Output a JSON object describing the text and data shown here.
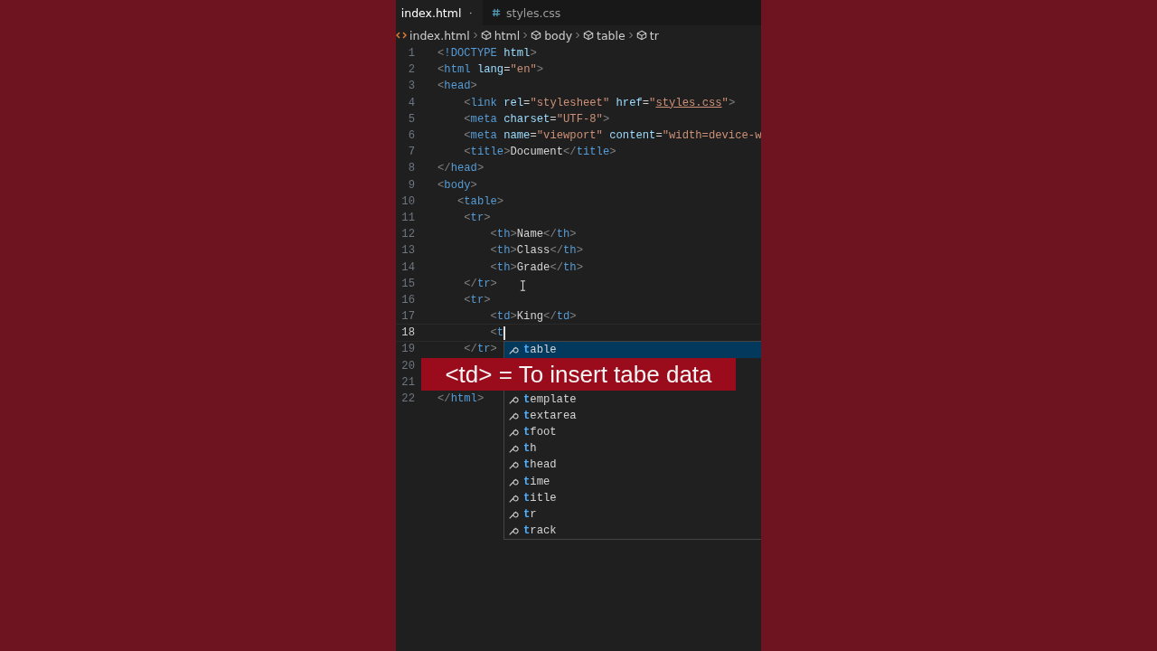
{
  "tabs": [
    {
      "label": "index.html",
      "selected": true,
      "modified": true
    },
    {
      "label": "styles.css",
      "selected": false,
      "modified": false
    }
  ],
  "breadcrumb": [
    {
      "label": "index.html"
    },
    {
      "label": "html"
    },
    {
      "label": "body"
    },
    {
      "label": "table"
    },
    {
      "label": "tr"
    }
  ],
  "lines": [
    {
      "number": "1",
      "current": false,
      "tokens": [
        {
          "t": "<",
          "kind": "punct"
        },
        {
          "t": "!DOCTYPE",
          "kind": "tag"
        },
        {
          "t": " html",
          "kind": "attr"
        },
        {
          "t": ">",
          "kind": "punct"
        }
      ]
    },
    {
      "number": "2",
      "current": false,
      "tokens": [
        {
          "t": "<",
          "kind": "punct"
        },
        {
          "t": "html",
          "kind": "tag"
        },
        {
          "t": " lang",
          "kind": "attr"
        },
        {
          "t": "=",
          "kind": "text"
        },
        {
          "t": "\"en\"",
          "kind": "string"
        },
        {
          "t": ">",
          "kind": "punct"
        }
      ]
    },
    {
      "number": "3",
      "current": false,
      "tokens": [
        {
          "t": "<",
          "kind": "punct"
        },
        {
          "t": "head",
          "kind": "tag"
        },
        {
          "t": ">",
          "kind": "punct"
        }
      ]
    },
    {
      "number": "4",
      "current": false,
      "tokens": [
        {
          "t": "    <",
          "kind": "punct"
        },
        {
          "t": "link",
          "kind": "tag"
        },
        {
          "t": " rel",
          "kind": "attr"
        },
        {
          "t": "=",
          "kind": "text"
        },
        {
          "t": "\"stylesheet\"",
          "kind": "string"
        },
        {
          "t": " href",
          "kind": "attr"
        },
        {
          "t": "=",
          "kind": "text"
        },
        {
          "t": "\"",
          "kind": "string"
        },
        {
          "t": "styles.css",
          "kind": "link"
        },
        {
          "t": "\"",
          "kind": "string"
        },
        {
          "t": ">",
          "kind": "punct"
        }
      ]
    },
    {
      "number": "5",
      "current": false,
      "tokens": [
        {
          "t": "    <",
          "kind": "punct"
        },
        {
          "t": "meta",
          "kind": "tag"
        },
        {
          "t": " charset",
          "kind": "attr"
        },
        {
          "t": "=",
          "kind": "text"
        },
        {
          "t": "\"UTF-8\"",
          "kind": "string"
        },
        {
          "t": ">",
          "kind": "punct"
        }
      ]
    },
    {
      "number": "6",
      "current": false,
      "tokens": [
        {
          "t": "    <",
          "kind": "punct"
        },
        {
          "t": "meta",
          "kind": "tag"
        },
        {
          "t": " name",
          "kind": "attr"
        },
        {
          "t": "=",
          "kind": "text"
        },
        {
          "t": "\"viewport\"",
          "kind": "string"
        },
        {
          "t": " content",
          "kind": "attr"
        },
        {
          "t": "=",
          "kind": "text"
        },
        {
          "t": "\"width=device-w",
          "kind": "string"
        }
      ]
    },
    {
      "number": "7",
      "current": false,
      "tokens": [
        {
          "t": "    <",
          "kind": "punct"
        },
        {
          "t": "title",
          "kind": "tag"
        },
        {
          "t": ">",
          "kind": "punct"
        },
        {
          "t": "Document",
          "kind": "text"
        },
        {
          "t": "</",
          "kind": "punct"
        },
        {
          "t": "title",
          "kind": "tag"
        },
        {
          "t": ">",
          "kind": "punct"
        }
      ]
    },
    {
      "number": "8",
      "current": false,
      "tokens": [
        {
          "t": "</",
          "kind": "punct"
        },
        {
          "t": "head",
          "kind": "tag"
        },
        {
          "t": ">",
          "kind": "punct"
        }
      ]
    },
    {
      "number": "9",
      "current": false,
      "tokens": [
        {
          "t": "<",
          "kind": "punct"
        },
        {
          "t": "body",
          "kind": "tag"
        },
        {
          "t": ">",
          "kind": "punct"
        }
      ]
    },
    {
      "number": "10",
      "current": false,
      "tokens": [
        {
          "t": "   <",
          "kind": "punct"
        },
        {
          "t": "table",
          "kind": "tag"
        },
        {
          "t": ">",
          "kind": "punct"
        }
      ]
    },
    {
      "number": "11",
      "current": false,
      "tokens": [
        {
          "t": "    <",
          "kind": "punct"
        },
        {
          "t": "tr",
          "kind": "tag"
        },
        {
          "t": ">",
          "kind": "punct"
        }
      ]
    },
    {
      "number": "12",
      "current": false,
      "tokens": [
        {
          "t": "        <",
          "kind": "punct"
        },
        {
          "t": "th",
          "kind": "tag"
        },
        {
          "t": ">",
          "kind": "punct"
        },
        {
          "t": "Name",
          "kind": "text"
        },
        {
          "t": "</",
          "kind": "punct"
        },
        {
          "t": "th",
          "kind": "tag"
        },
        {
          "t": ">",
          "kind": "punct"
        }
      ]
    },
    {
      "number": "13",
      "current": false,
      "tokens": [
        {
          "t": "        <",
          "kind": "punct"
        },
        {
          "t": "th",
          "kind": "tag"
        },
        {
          "t": ">",
          "kind": "punct"
        },
        {
          "t": "Class",
          "kind": "text"
        },
        {
          "t": "</",
          "kind": "punct"
        },
        {
          "t": "th",
          "kind": "tag"
        },
        {
          "t": ">",
          "kind": "punct"
        }
      ]
    },
    {
      "number": "14",
      "current": false,
      "tokens": [
        {
          "t": "        <",
          "kind": "punct"
        },
        {
          "t": "th",
          "kind": "tag"
        },
        {
          "t": ">",
          "kind": "punct"
        },
        {
          "t": "Grade",
          "kind": "text"
        },
        {
          "t": "</",
          "kind": "punct"
        },
        {
          "t": "th",
          "kind": "tag"
        },
        {
          "t": ">",
          "kind": "punct"
        }
      ]
    },
    {
      "number": "15",
      "current": false,
      "tokens": [
        {
          "t": "    </",
          "kind": "punct"
        },
        {
          "t": "tr",
          "kind": "tag"
        },
        {
          "t": ">",
          "kind": "punct"
        }
      ]
    },
    {
      "number": "16",
      "current": false,
      "tokens": [
        {
          "t": "    <",
          "kind": "punct"
        },
        {
          "t": "tr",
          "kind": "tag"
        },
        {
          "t": ">",
          "kind": "punct"
        }
      ]
    },
    {
      "number": "17",
      "current": false,
      "tokens": [
        {
          "t": "        <",
          "kind": "punct"
        },
        {
          "t": "td",
          "kind": "tag"
        },
        {
          "t": ">",
          "kind": "punct"
        },
        {
          "t": "King",
          "kind": "text"
        },
        {
          "t": "</",
          "kind": "punct"
        },
        {
          "t": "td",
          "kind": "tag"
        },
        {
          "t": ">",
          "kind": "punct"
        }
      ]
    },
    {
      "number": "18",
      "current": true,
      "tokens": [
        {
          "t": "        <",
          "kind": "punct"
        },
        {
          "t": "t",
          "kind": "tag"
        }
      ]
    },
    {
      "number": "19",
      "current": false,
      "tokens": [
        {
          "t": "    </",
          "kind": "punct"
        },
        {
          "t": "tr",
          "kind": "tag"
        },
        {
          "t": ">",
          "kind": "punct"
        }
      ]
    },
    {
      "number": "20",
      "current": false
    },
    {
      "number": "21",
      "current": false
    },
    {
      "number": "22",
      "current": false,
      "tokens": [
        {
          "t": "</",
          "kind": "punct"
        },
        {
          "t": "html",
          "kind": "tag"
        },
        {
          "t": ">",
          "kind": "punct"
        }
      ]
    }
  ],
  "suggestions": [
    {
      "match": "t",
      "rest": "able",
      "selected": true
    },
    {
      "match": "t",
      "rest": "emplate",
      "selected": false
    },
    {
      "match": "t",
      "rest": "extarea",
      "selected": false
    },
    {
      "match": "t",
      "rest": "foot",
      "selected": false
    },
    {
      "match": "t",
      "rest": "h",
      "selected": false
    },
    {
      "match": "t",
      "rest": "head",
      "selected": false
    },
    {
      "match": "t",
      "rest": "ime",
      "selected": false
    },
    {
      "match": "t",
      "rest": "itle",
      "selected": false
    },
    {
      "match": "t",
      "rest": "r",
      "selected": false
    },
    {
      "match": "t",
      "rest": "rack",
      "selected": false
    }
  ],
  "caption": "<td> = To insert tabe data"
}
